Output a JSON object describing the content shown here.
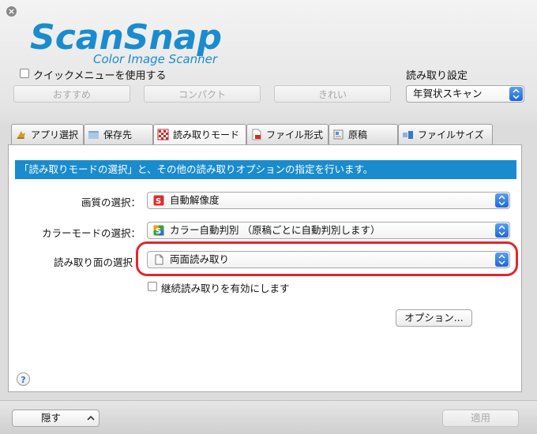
{
  "brand": {
    "logo_text": "ScanSnap",
    "logo_subtext": "Color Image Scanner"
  },
  "quick_menu": {
    "label": "クイックメニューを使用する",
    "checked": false
  },
  "presets": [
    "おすすめ",
    "コンパクト",
    "きれい"
  ],
  "profile": {
    "label": "読み取り設定",
    "selected": "年賀状スキャン"
  },
  "tabs": [
    {
      "label": "アプリ選択",
      "icon": "app-icon"
    },
    {
      "label": "保存先",
      "icon": "folder-icon"
    },
    {
      "label": "読み取りモード",
      "icon": "scan-mode-icon",
      "active": true
    },
    {
      "label": "ファイル形式",
      "icon": "pdf-file-icon"
    },
    {
      "label": "原稿",
      "icon": "document-icon"
    },
    {
      "label": "ファイルサイズ",
      "icon": "file-size-icon"
    }
  ],
  "panel": {
    "banner": "「読み取りモードの選択」と、その他の読み取りオプションの指定を行います。",
    "rows": [
      {
        "label": "画質の選択：",
        "value": "自動解像度",
        "icon": "quality-icon"
      },
      {
        "label": "カラーモードの選択：",
        "value": "カラー自動判別 （原稿ごとに自動判別します）",
        "icon": "color-mode-icon"
      },
      {
        "label": "読み取り面の選択",
        "value": "両面読み取り",
        "icon": "duplex-icon"
      }
    ],
    "continuous": {
      "label": "継続読み取りを有効にします",
      "checked": false
    },
    "options_button": "オプション...",
    "help": "?"
  },
  "footer": {
    "hide_button": "隠す",
    "apply_button": "適用"
  },
  "colors": {
    "banner": "#1a8ccd",
    "logo": "#1a8ccd",
    "highlight": "#e3262e",
    "select_arrow": "#1f66d6"
  }
}
